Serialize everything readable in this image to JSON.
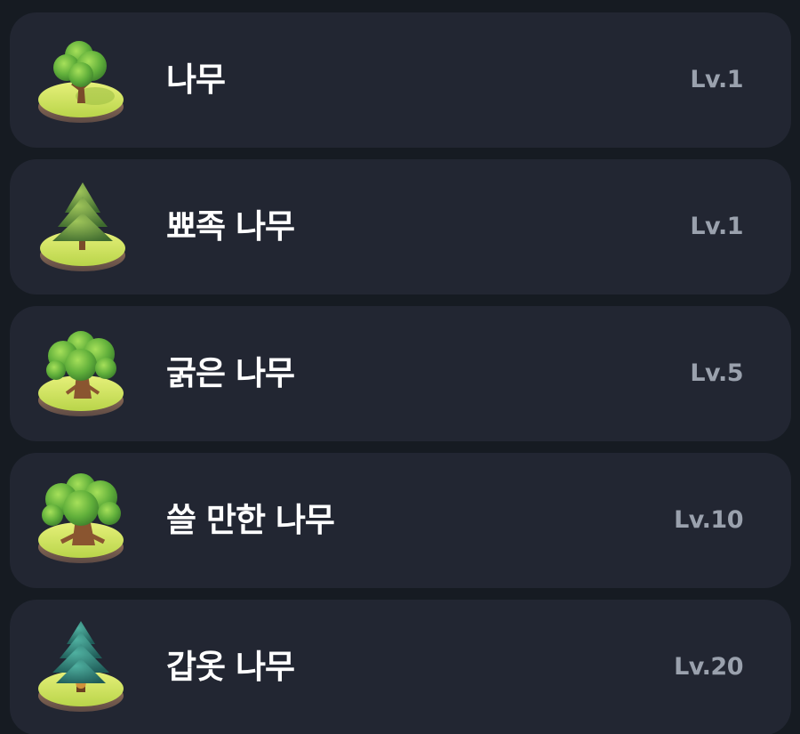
{
  "colors": {
    "background": "#161b22",
    "card": "#222632",
    "name_text": "#ffffff",
    "level_text": "#9aa1ad"
  },
  "trees": [
    {
      "name": "나무",
      "level": "Lv.1",
      "icon": "broadleaf-tree-icon"
    },
    {
      "name": "뾰족 나무",
      "level": "Lv.1",
      "icon": "pine-tree-icon"
    },
    {
      "name": "굵은 나무",
      "level": "Lv.5",
      "icon": "thick-tree-icon"
    },
    {
      "name": "쓸 만한 나무",
      "level": "Lv.10",
      "icon": "useful-tree-icon"
    },
    {
      "name": "갑옷 나무",
      "level": "Lv.20",
      "icon": "armor-tree-icon"
    }
  ]
}
